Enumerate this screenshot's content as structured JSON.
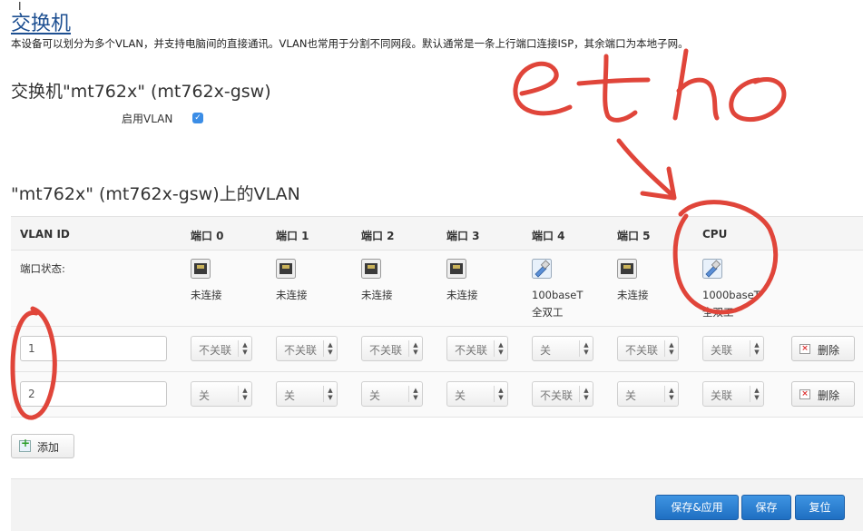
{
  "page": {
    "title": "交换机",
    "description": "本设备可以划分为多个VLAN，并支持电脑间的直接通讯。VLAN也常用于分割不同网段。默认通常是一条上行端口连接ISP，其余端口为本地子网。"
  },
  "switch_section": {
    "title": "交换机\"mt762x\" (mt762x-gsw)",
    "enable_vlan_label": "启用VLAN",
    "enable_vlan_checked": true
  },
  "vlan_section": {
    "title": "\"mt762x\" (mt762x-gsw)上的VLAN",
    "columns": [
      "VLAN ID",
      "端口 0",
      "端口 1",
      "端口 2",
      "端口 3",
      "端口 4",
      "端口 5",
      "CPU"
    ],
    "port_status_label": "端口状态:",
    "port_status": [
      {
        "line1": "未连接",
        "line2": "",
        "icon": "ethernet-port-disconnected-icon"
      },
      {
        "line1": "未连接",
        "line2": "",
        "icon": "ethernet-port-disconnected-icon"
      },
      {
        "line1": "未连接",
        "line2": "",
        "icon": "ethernet-port-disconnected-icon"
      },
      {
        "line1": "未连接",
        "line2": "",
        "icon": "ethernet-port-disconnected-icon"
      },
      {
        "line1": "100baseT",
        "line2": "全双工",
        "icon": "ethernet-port-connected-icon"
      },
      {
        "line1": "未连接",
        "line2": "",
        "icon": "ethernet-port-disconnected-icon"
      },
      {
        "line1": "1000baseT",
        "line2": "全双工",
        "icon": "ethernet-port-connected-icon"
      }
    ],
    "rows": [
      {
        "vlan_id": "1",
        "ports": [
          "不关联",
          "不关联",
          "不关联",
          "不关联",
          "关",
          "不关联",
          "关联"
        ],
        "delete_label": "删除"
      },
      {
        "vlan_id": "2",
        "ports": [
          "关",
          "关",
          "关",
          "关",
          "不关联",
          "关",
          "关联"
        ],
        "delete_label": "删除"
      }
    ],
    "add_label": "添加"
  },
  "footer": {
    "save_apply_label": "保存&应用",
    "save_label": "保存",
    "reset_label": "复位"
  },
  "annotation": {
    "handwritten_text": "etho",
    "color": "#e0453a"
  },
  "colors": {
    "title_link": "#1d4f91",
    "primary_button": "#2a7dd1",
    "checkbox": "#3b8de6"
  }
}
